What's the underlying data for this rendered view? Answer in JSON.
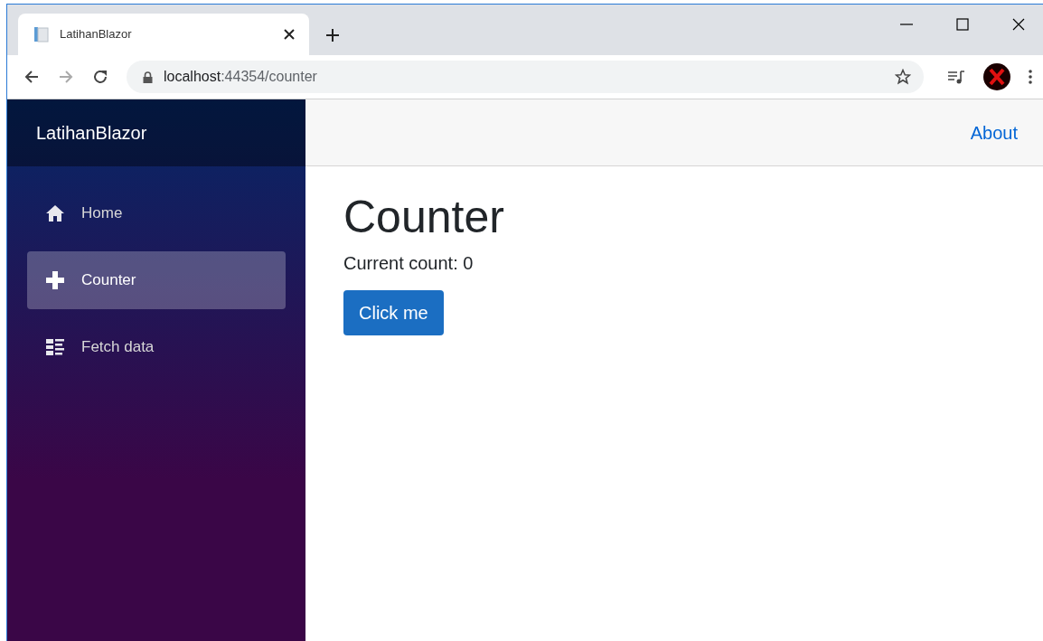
{
  "browser": {
    "tab": {
      "title": "LatihanBlazor"
    },
    "address": {
      "host": "localhost",
      "path": ":44354/counter"
    }
  },
  "sidebar": {
    "brand": "LatihanBlazor",
    "items": [
      {
        "label": "Home",
        "kind": "home",
        "selected": false
      },
      {
        "label": "Counter",
        "kind": "plus",
        "selected": true
      },
      {
        "label": "Fetch data",
        "kind": "list",
        "selected": false
      }
    ]
  },
  "top_row": {
    "link": "About"
  },
  "content": {
    "heading": "Counter",
    "count_text": "Current count: 0",
    "button": "Click me"
  }
}
